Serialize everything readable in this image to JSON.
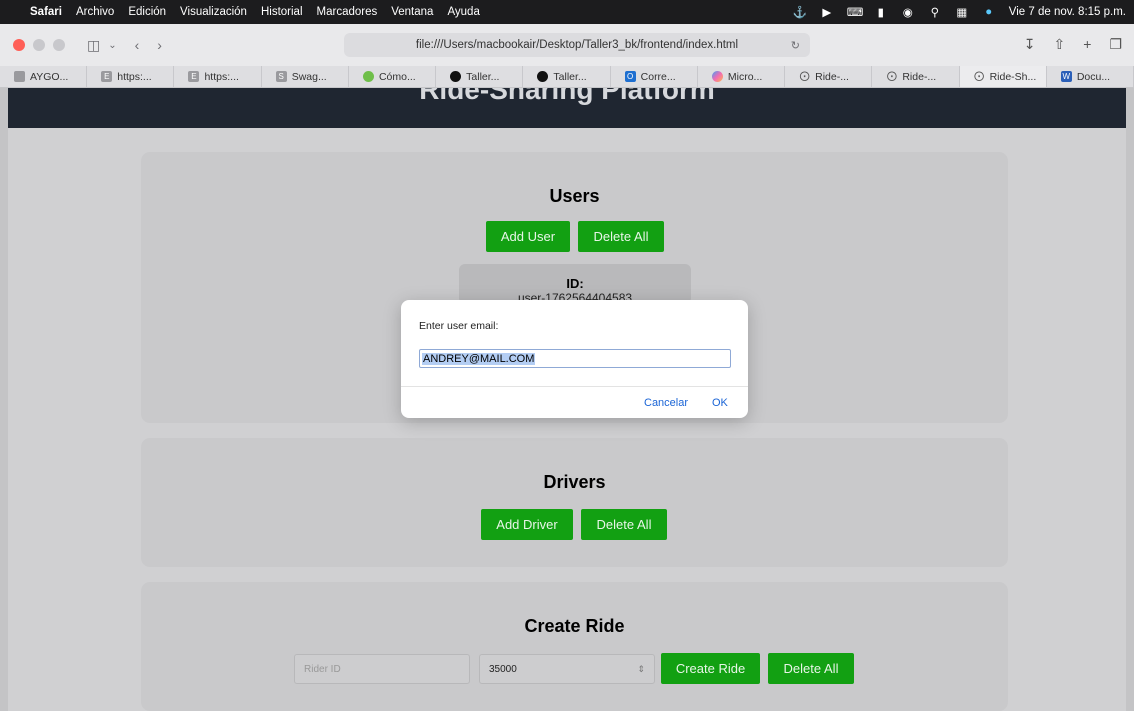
{
  "menubar": {
    "app": "Safari",
    "items": [
      "Archivo",
      "Edición",
      "Visualización",
      "Historial",
      "Marcadores",
      "Ventana",
      "Ayuda"
    ],
    "clock": "Vie 7 de nov.  8:15 p.m."
  },
  "browser": {
    "url": "file:///Users/macbookair/Desktop/Taller3_bk/frontend/index.html",
    "tabs": [
      {
        "label": "AYGO...",
        "icon": "gray"
      },
      {
        "label": "https:...",
        "icon": "gray"
      },
      {
        "label": "https:...",
        "icon": "gray"
      },
      {
        "label": "Swag...",
        "icon": "gray"
      },
      {
        "label": "Cómo...",
        "icon": "green"
      },
      {
        "label": "Taller...",
        "icon": "github"
      },
      {
        "label": "Taller...",
        "icon": "github"
      },
      {
        "label": "Corre...",
        "icon": "outlook"
      },
      {
        "label": "Micro...",
        "icon": "copilot"
      },
      {
        "label": "Ride-...",
        "icon": "compass"
      },
      {
        "label": "Ride-...",
        "icon": "compass"
      },
      {
        "label": "Ride-Sh...",
        "icon": "compass"
      },
      {
        "label": "Docu...",
        "icon": "word"
      }
    ],
    "active_tab": 11
  },
  "page": {
    "title": "Ride-Sharing Platform",
    "users": {
      "title": "Users",
      "add_label": "Add User",
      "delete_label": "Delete All",
      "card_id_label": "ID:",
      "card_id_value": "user-1762564404583"
    },
    "drivers": {
      "title": "Drivers",
      "add_label": "Add Driver",
      "delete_label": "Delete All"
    },
    "rides": {
      "title": "Create Ride",
      "rider_placeholder": "Rider ID",
      "fare_value": "35000",
      "create_label": "Create Ride",
      "delete_label": "Delete All"
    }
  },
  "dialog": {
    "prompt": "Enter user email:",
    "value": "ANDREY@MAIL.COM",
    "cancel_label": "Cancelar",
    "ok_label": "OK"
  }
}
